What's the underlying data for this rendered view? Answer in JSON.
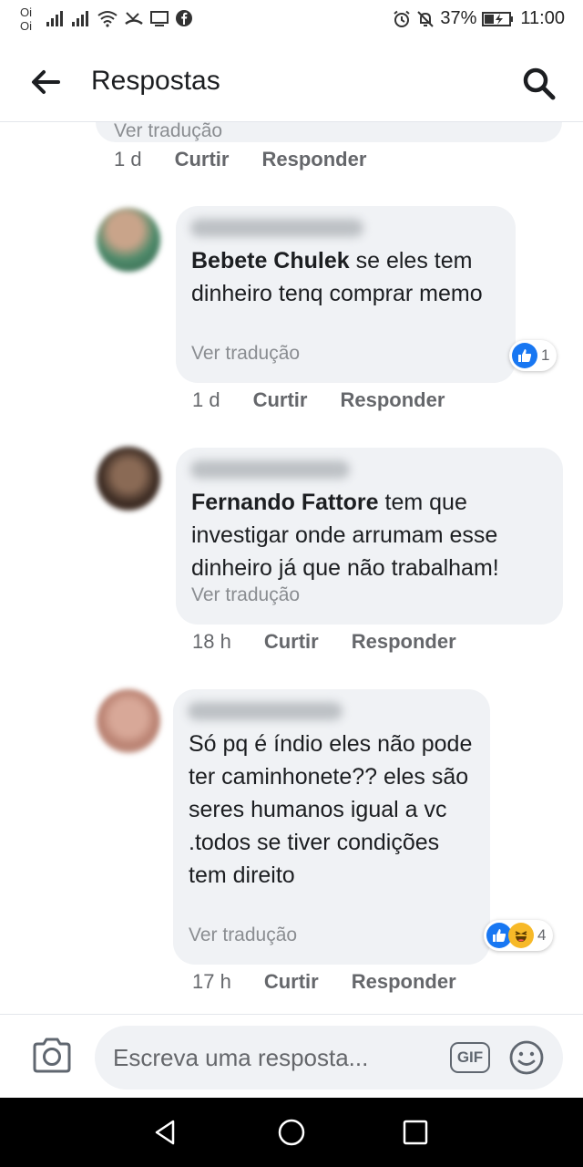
{
  "status_bar": {
    "carrier_1": "Oi",
    "carrier_2": "Oi",
    "battery": "37%",
    "time": "11:00"
  },
  "header": {
    "title": "Respostas"
  },
  "thread": {
    "top_comment": {
      "translate_label": "Ver tradução",
      "time": "1 d",
      "like_label": "Curtir",
      "reply_label": "Responder"
    },
    "comments": [
      {
        "mention": "Bebete Chulek",
        "text": " se eles tem dinheiro tenq comprar memo",
        "translate_label": "Ver tradução",
        "time": "1 d",
        "like_label": "Curtir",
        "reply_label": "Responder",
        "reaction_count": "1",
        "reaction_types": [
          "like-icon"
        ]
      },
      {
        "mention": "Fernando Fattore",
        "text": " tem que investigar onde arrumam esse dinheiro já que não trabalham!",
        "translate_label": "Ver tradução",
        "time": "18 h",
        "like_label": "Curtir",
        "reply_label": "Responder"
      },
      {
        "mention": "",
        "text": "Só  pq é  índio eles não pode ter caminhonete?? eles são  seres humanos igual a vc .todos se tiver condições  tem direito",
        "translate_label": "Ver tradução",
        "time": "17 h",
        "like_label": "Curtir",
        "reply_label": "Responder",
        "reaction_count": "4",
        "reaction_types": [
          "like-icon",
          "haha-icon"
        ]
      }
    ]
  },
  "composer": {
    "placeholder": "Escreva uma resposta...",
    "gif_label": "GIF"
  },
  "colors": {
    "bubble": "#f0f2f5",
    "meta_text": "#65676b",
    "like_blue": "#1877f2",
    "haha_yellow": "#f7b928"
  }
}
